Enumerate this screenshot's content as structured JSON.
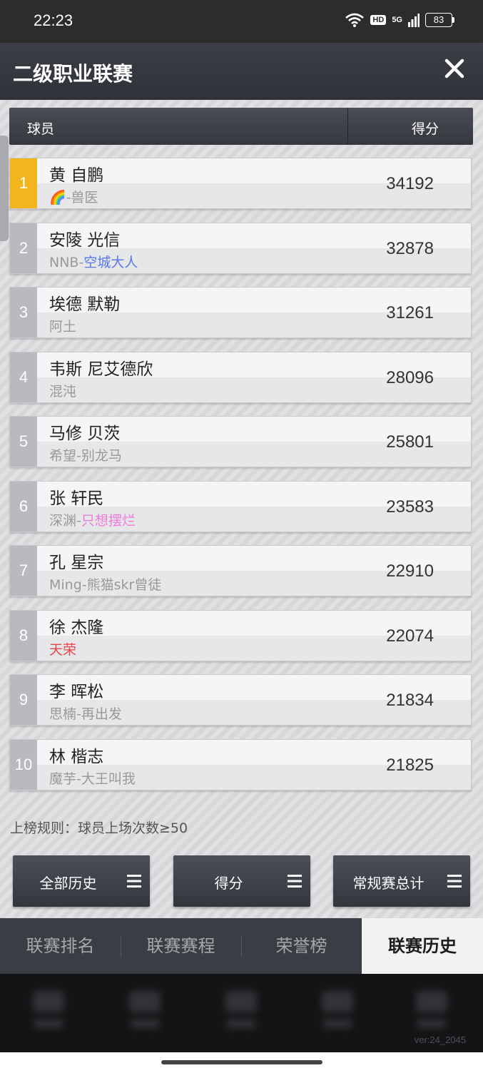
{
  "status_bar": {
    "time": "22:23",
    "hd_label": "HD",
    "network_label": "5G",
    "battery": "83"
  },
  "header": {
    "title": "二级职业联赛",
    "close_icon": "close-icon"
  },
  "table": {
    "col_player": "球员",
    "col_score": "得分",
    "rows": [
      {
        "rank": "1",
        "name": "黄 自鹏",
        "team_prefix": "🌈-",
        "team_highlight": "",
        "team_suffix": "兽医",
        "score": "34192"
      },
      {
        "rank": "2",
        "name": "安陵 光信",
        "team_prefix": "NNB-",
        "team_highlight": "空城大人",
        "team_suffix": "",
        "score": "32878"
      },
      {
        "rank": "3",
        "name": "埃德 默勒",
        "team_prefix": "",
        "team_highlight": "",
        "team_suffix": "阿土",
        "score": "31261"
      },
      {
        "rank": "4",
        "name": "韦斯 尼艾德欣",
        "team_prefix": "",
        "team_highlight": "",
        "team_suffix": "混沌",
        "score": "28096"
      },
      {
        "rank": "5",
        "name": "马修 贝茨",
        "team_prefix": "",
        "team_highlight": "",
        "team_suffix": "希望-别龙马",
        "score": "25801"
      },
      {
        "rank": "6",
        "name": "张 轩民",
        "team_prefix": "深渊-",
        "team_highlight": "只想摆烂",
        "team_suffix": "",
        "score": "23583"
      },
      {
        "rank": "7",
        "name": "孔 星宗",
        "team_prefix": "",
        "team_highlight": "",
        "team_suffix": "Ming-熊猫skr曾徒",
        "score": "22910"
      },
      {
        "rank": "8",
        "name": "徐 杰隆",
        "team_prefix": "",
        "team_highlight": "天荣",
        "team_suffix": "",
        "score": "22074"
      },
      {
        "rank": "9",
        "name": "李 晖松",
        "team_prefix": "",
        "team_highlight": "",
        "team_suffix": "思楠-再出发",
        "score": "21834"
      },
      {
        "rank": "10",
        "name": "林 楷志",
        "team_prefix": "",
        "team_highlight": "",
        "team_suffix": "魔芋-大王叫我",
        "score": "21825"
      }
    ]
  },
  "rule_text": "上榜规则：球员上场次数≥50",
  "filters": {
    "history": "全部历史",
    "stat": "得分",
    "season": "常规赛总计"
  },
  "tabs": {
    "ranking": "联赛排名",
    "schedule": "联赛赛程",
    "honors": "荣誉榜",
    "history": "联赛历史"
  },
  "version": "ver:24_2045",
  "colors": {
    "gold_rank": "#f2b51e",
    "blue_team": "#5a78f0",
    "pink_team": "#f07ad8",
    "red_team": "#e8424a"
  }
}
